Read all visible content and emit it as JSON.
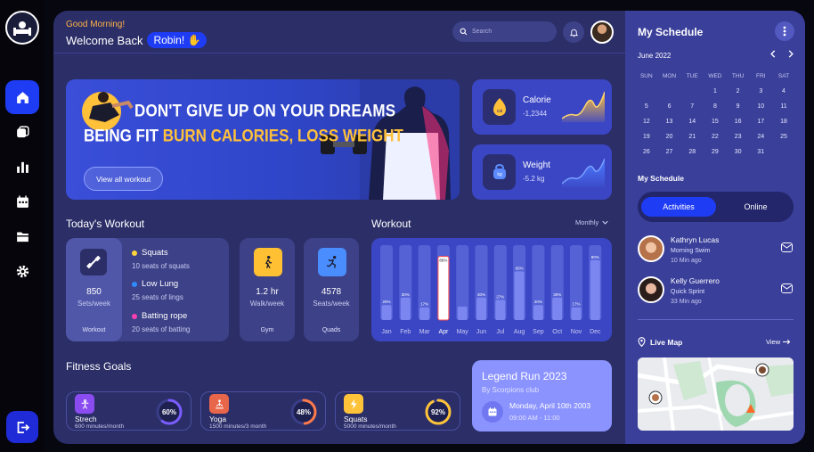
{
  "header": {
    "greeting": "Good Morning!",
    "welcome": "Welcome Back",
    "user_name": "Robin!",
    "search_placeholder": "Search"
  },
  "banner": {
    "line1": "DON'T GIVE UP ON YOUR DREAMS",
    "line2_white": "BEING FIT ",
    "line2_yellow": "BURN CALORIES, LOSS WEIGHT",
    "button": "View all workout"
  },
  "stats": [
    {
      "label": "Calorie",
      "value": "-1,2344",
      "icon_text": "cal"
    },
    {
      "label": "Weight",
      "value": "-5.2 kg",
      "icon_text": "kg"
    }
  ],
  "today": {
    "title": "Today's Workout",
    "main": {
      "value": "850",
      "unit": "Sets/week",
      "footer": "Workout"
    },
    "items": [
      {
        "name": "Squats",
        "sub": "10 seats of squats",
        "color": "#ffd43b"
      },
      {
        "name": "Low Lung",
        "sub": "25 seats of lings",
        "color": "#2f8bff"
      },
      {
        "name": "Batting rope",
        "sub": "20 seats of batting",
        "color": "#ff3fb0"
      }
    ],
    "gym": {
      "value": "1.2 hr",
      "unit": "Walk/week",
      "footer": "Gym"
    },
    "quads": {
      "value": "4578",
      "unit": "Seats/week",
      "footer": "Quads"
    }
  },
  "workout_chart": {
    "title": "Workout",
    "period": "Monthly"
  },
  "chart_data": {
    "type": "bar",
    "categories": [
      "Jan",
      "Feb",
      "Mar",
      "Apr",
      "May",
      "Jun",
      "Jul",
      "Aug",
      "Sep",
      "Oct",
      "Nov",
      "Dec"
    ],
    "values": [
      20,
      30,
      17,
      85,
      18,
      30,
      27,
      65,
      20,
      30,
      17,
      80
    ],
    "labels": [
      "20%",
      "30%",
      "17%",
      "86%",
      "",
      "30%",
      "27%",
      "65%",
      "20%",
      "30%",
      "17%",
      "80%"
    ],
    "highlight": "Apr",
    "ylim": [
      0,
      100
    ]
  },
  "goals": {
    "title": "Fitness Goals",
    "items": [
      {
        "name": "Strech",
        "sub": "600 minutes/month",
        "percent": "60%",
        "pct": 60,
        "color": "#8a4cf0",
        "ring": "#7a5cff"
      },
      {
        "name": "Yoga",
        "sub": "1500 minutes/3 month",
        "percent": "48%",
        "pct": 48,
        "color": "#e8664a",
        "ring": "#ff7a4a"
      },
      {
        "name": "Squats",
        "sub": "5000 minutes/month",
        "percent": "92%",
        "pct": 92,
        "color": "#ffc33a",
        "ring": "#ffc33a"
      }
    ]
  },
  "event": {
    "title": "Legend Run 2023",
    "club": "By Scorpions club",
    "date": "Monday, April 10th 2003",
    "time": "09:00 AM - 11:00"
  },
  "schedule": {
    "title": "My Schedule",
    "month": "June 2022",
    "weekdays": [
      "SUN",
      "MON",
      "TUE",
      "WED",
      "THU",
      "FRI",
      "SAT"
    ],
    "weeks": [
      [
        "",
        "",
        "",
        "1",
        "2",
        "3",
        "4"
      ],
      [
        "5",
        "6",
        "7",
        "8",
        "9",
        "10",
        "11"
      ],
      [
        "12",
        "13",
        "14",
        "15",
        "16",
        "17",
        "18"
      ],
      [
        "19",
        "20",
        "21",
        "22",
        "23",
        "24",
        "25"
      ],
      [
        "26",
        "27",
        "28",
        "29",
        "30",
        "31",
        ""
      ]
    ],
    "sub_title": "My Schedule",
    "tabs": [
      "Activities",
      "Online"
    ],
    "people": [
      {
        "name": "Kathryn Lucas",
        "event": "Morning Swim",
        "time": "10 Min ago"
      },
      {
        "name": "Kelly Guerrero",
        "event": "Quick Sprint",
        "time": "33 Min ago"
      }
    ],
    "map_title": "Live Map",
    "map_view": "View"
  }
}
